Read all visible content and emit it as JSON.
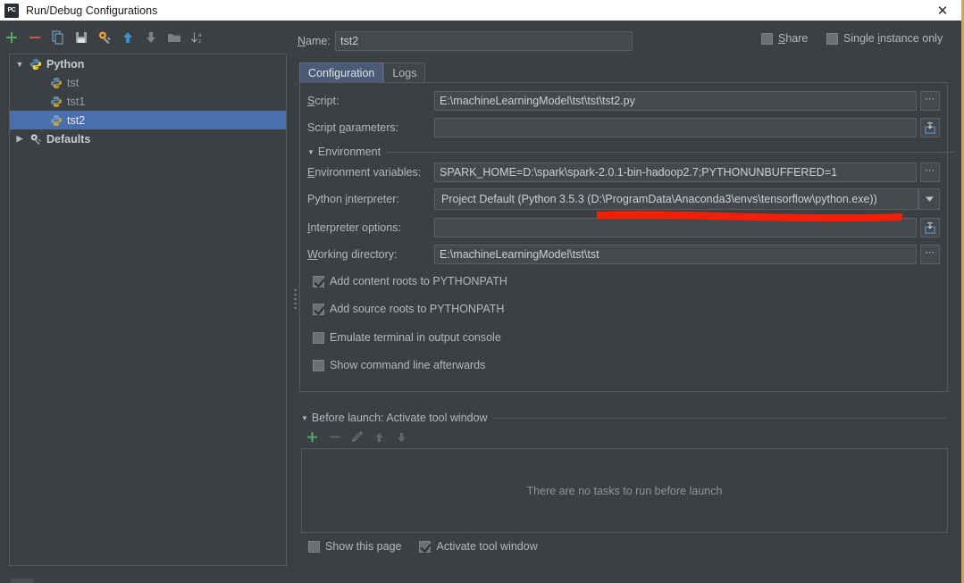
{
  "window": {
    "title": "Run/Debug Configurations",
    "app_icon": "pycharm-icon",
    "close_label": "✕",
    "accent_border": "#c9a85c",
    "titlebar_bg": "#ffffff",
    "panel_bg": "#3c4043",
    "selection_color": "#4b6eaf"
  },
  "left_toolbar": {
    "buttons": [
      {
        "name": "add-configuration-button",
        "icon": "plus-icon",
        "tooltip": "Add New Configuration"
      },
      {
        "name": "remove-configuration-button",
        "icon": "minus-icon",
        "tooltip": "Remove Configuration"
      },
      {
        "name": "copy-configuration-button",
        "icon": "copy-icon",
        "tooltip": "Copy Configuration"
      },
      {
        "name": "save-configuration-button",
        "icon": "save-icon",
        "tooltip": "Save Configuration"
      },
      {
        "name": "edit-defaults-button",
        "icon": "gear-wrench-icon",
        "tooltip": "Edit defaults"
      },
      {
        "name": "move-up-button",
        "icon": "arrow-up-icon",
        "tooltip": "Move Up"
      },
      {
        "name": "move-down-button",
        "icon": "arrow-down-icon",
        "tooltip": "Move Down"
      },
      {
        "name": "new-folder-button",
        "icon": "folder-icon",
        "tooltip": "Create New Folder"
      },
      {
        "name": "sort-button",
        "icon": "sort-alpha-icon",
        "tooltip": "Sort Configurations"
      }
    ]
  },
  "tree": {
    "items": [
      {
        "label": "Python",
        "level": 0,
        "expanded": true,
        "icon": "python-icon",
        "selected": false
      },
      {
        "label": "tst",
        "level": 1,
        "expanded": null,
        "icon": "python-config-icon",
        "selected": false
      },
      {
        "label": "tst1",
        "level": 1,
        "expanded": null,
        "icon": "python-config-icon",
        "selected": false
      },
      {
        "label": "tst2",
        "level": 1,
        "expanded": null,
        "icon": "python-config-icon",
        "selected": true
      },
      {
        "label": "Defaults",
        "level": 0,
        "expanded": false,
        "icon": "gear-wrench-icon",
        "selected": false
      }
    ]
  },
  "header": {
    "name_label": "Name:",
    "name_mnemonic": "N",
    "name_value": "tst2",
    "share_label": "Share",
    "share_mnemonic": "S",
    "share_checked": false,
    "single_instance_label": "Single instance only",
    "single_instance_checked": false
  },
  "tabs": [
    {
      "label": "Configuration",
      "active": true
    },
    {
      "label": "Logs",
      "active": false
    }
  ],
  "config": {
    "script": {
      "label": "Script:",
      "mnemonic": "S",
      "value": "E:\\machineLearningModel\\tst\\tst\\tst2.py",
      "button_icon": "ellipsis-icon"
    },
    "script_parameters": {
      "label": "Script parameters:",
      "mnemonic": "p",
      "value": "",
      "button_icon": "expand-editor-icon"
    },
    "environment_section": {
      "label": "Environment",
      "expanded": true
    },
    "environment_variables": {
      "label": "Environment variables:",
      "mnemonic": "E",
      "value": "SPARK_HOME=D:\\spark\\spark-2.0.1-bin-hadoop2.7;PYTHONUNBUFFERED=1",
      "button_icon": "ellipsis-icon"
    },
    "python_interpreter": {
      "label": "Python interpreter:",
      "mnemonic": "i",
      "value": "Project Default (Python 3.5.3 (D:\\ProgramData\\Anaconda3\\envs\\tensorflow\\python.exe))",
      "button_icon": "chevron-down-icon"
    },
    "interpreter_options": {
      "label": "Interpreter options:",
      "mnemonic": "I",
      "value": "",
      "button_icon": "expand-editor-icon"
    },
    "working_directory": {
      "label": "Working directory:",
      "mnemonic": "W",
      "value": "E:\\machineLearningModel\\tst\\tst",
      "button_icon": "ellipsis-icon"
    },
    "checkboxes": [
      {
        "label": "Add content roots to PYTHONPATH",
        "checked": true,
        "name": "add-content-roots-checkbox"
      },
      {
        "label": "Add source roots to PYTHONPATH",
        "checked": true,
        "name": "add-source-roots-checkbox"
      },
      {
        "label": "Emulate terminal in output console",
        "checked": false,
        "name": "emulate-terminal-checkbox"
      },
      {
        "label": "Show command line afterwards",
        "checked": false,
        "name": "show-command-line-checkbox"
      }
    ]
  },
  "before_launch": {
    "section_label": "Before launch: Activate tool window",
    "section_mnemonic": "B",
    "expanded": true,
    "toolbar": [
      {
        "name": "add-task-button",
        "icon": "plus-icon",
        "enabled": true
      },
      {
        "name": "remove-task-button",
        "icon": "minus-icon",
        "enabled": false
      },
      {
        "name": "edit-task-button",
        "icon": "pencil-icon",
        "enabled": false
      },
      {
        "name": "task-move-up-button",
        "icon": "arrow-up-icon",
        "enabled": false
      },
      {
        "name": "task-move-down-button",
        "icon": "arrow-down-icon",
        "enabled": false
      }
    ],
    "empty_message": "There are no tasks to run before launch",
    "options": [
      {
        "label": "Show this page",
        "checked": false,
        "name": "show-this-page-checkbox"
      },
      {
        "label": "Activate tool window",
        "checked": true,
        "name": "activate-tool-window-checkbox"
      }
    ]
  },
  "annotation": {
    "type": "freehand-underline",
    "color": "#f41f07",
    "target": "python_interpreter_path"
  }
}
